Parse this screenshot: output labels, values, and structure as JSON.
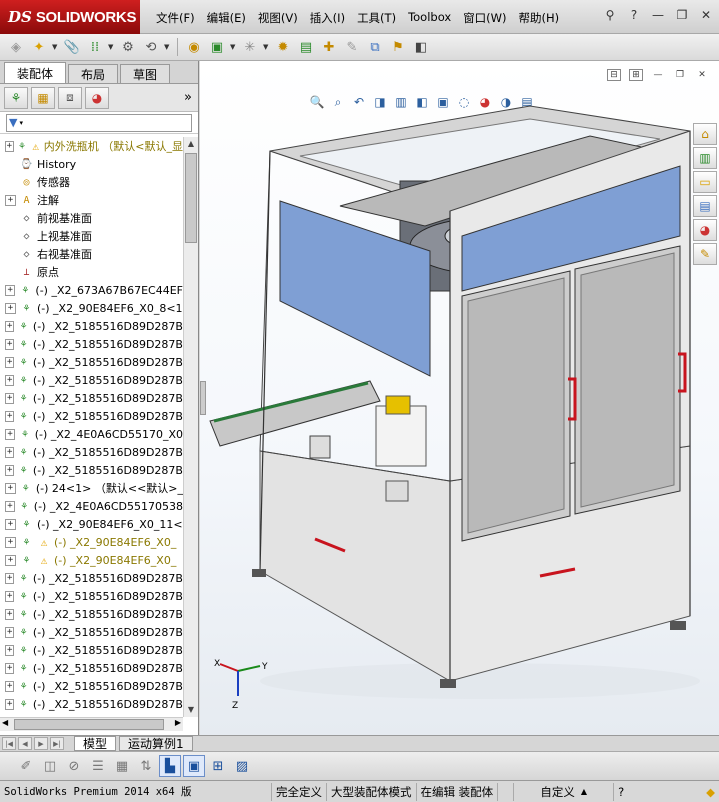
{
  "titlebar": {
    "logo_ds": "DS",
    "logo_text": "SOLIDWORKS",
    "menu": [
      "文件(F)",
      "编辑(E)",
      "视图(V)",
      "插入(I)",
      "工具(T)",
      "Toolbox",
      "窗口(W)",
      "帮助(H)"
    ]
  },
  "window_controls": {
    "help": "?",
    "minimize": "—",
    "restore": "❐",
    "close": "✕"
  },
  "left_panel": {
    "tabs": [
      "装配体",
      "布局",
      "草图"
    ],
    "active_tab": "装配体",
    "collapse_symbol": "»",
    "tree": [
      {
        "expand": "+",
        "icon": "assembly",
        "warn": true,
        "label": "内外洗瓶机  （默认<默认_显"
      },
      {
        "expand": "",
        "icon": "history",
        "label": "History"
      },
      {
        "expand": "",
        "icon": "sensor",
        "label": "传感器"
      },
      {
        "expand": "+",
        "icon": "annotation",
        "label": "注解"
      },
      {
        "expand": "",
        "icon": "plane",
        "label": "前视基准面"
      },
      {
        "expand": "",
        "icon": "plane",
        "label": "上视基准面"
      },
      {
        "expand": "",
        "icon": "plane",
        "label": "右视基准面"
      },
      {
        "expand": "",
        "icon": "origin",
        "label": "原点"
      },
      {
        "expand": "+",
        "icon": "part",
        "label": "(-) _X2_673A67B67EC44EF"
      },
      {
        "expand": "+",
        "icon": "part",
        "label": "(-) _X2_90E84EF6_X0_8<1"
      },
      {
        "expand": "+",
        "icon": "part",
        "label": "(-) _X2_5185516D89D287B"
      },
      {
        "expand": "+",
        "icon": "part",
        "label": "(-) _X2_5185516D89D287B"
      },
      {
        "expand": "+",
        "icon": "part",
        "label": "(-) _X2_5185516D89D287B"
      },
      {
        "expand": "+",
        "icon": "part",
        "label": "(-) _X2_5185516D89D287B"
      },
      {
        "expand": "+",
        "icon": "part",
        "label": "(-) _X2_5185516D89D287B"
      },
      {
        "expand": "+",
        "icon": "part",
        "label": "(-) _X2_5185516D89D287B"
      },
      {
        "expand": "+",
        "icon": "part",
        "label": "(-) _X2_4E0A6CD55170_X0"
      },
      {
        "expand": "+",
        "icon": "part",
        "label": "(-) _X2_5185516D89D287B"
      },
      {
        "expand": "+",
        "icon": "part",
        "label": "(-) _X2_5185516D89D287B"
      },
      {
        "expand": "+",
        "icon": "part",
        "label": "(-) 24<1> （默认<<默认>_"
      },
      {
        "expand": "+",
        "icon": "part",
        "label": "(-) _X2_4E0A6CD55170538"
      },
      {
        "expand": "+",
        "icon": "part",
        "label": "(-) _X2_90E84EF6_X0_11<"
      },
      {
        "expand": "+",
        "icon": "part",
        "warn": true,
        "label": "(-) _X2_90E84EF6_X0_"
      },
      {
        "expand": "+",
        "icon": "part",
        "warn": true,
        "label": "(-) _X2_90E84EF6_X0_"
      },
      {
        "expand": "+",
        "icon": "part",
        "label": "(-) _X2_5185516D89D287B"
      },
      {
        "expand": "+",
        "icon": "part",
        "label": "(-) _X2_5185516D89D287B"
      },
      {
        "expand": "+",
        "icon": "part",
        "label": "(-) _X2_5185516D89D287B"
      },
      {
        "expand": "+",
        "icon": "part",
        "label": "(-) _X2_5185516D89D287B"
      },
      {
        "expand": "+",
        "icon": "part",
        "label": "(-) _X2_5185516D89D287B"
      },
      {
        "expand": "+",
        "icon": "part",
        "label": "(-) _X2_5185516D89D287B"
      },
      {
        "expand": "+",
        "icon": "part",
        "label": "(-) _X2_5185516D89D287B"
      },
      {
        "expand": "+",
        "icon": "part",
        "label": "(-) _X2_5185516D89D287B"
      },
      {
        "expand": "+",
        "icon": "part",
        "label": "(-) _X2_5185516D89D287B"
      }
    ]
  },
  "triad": {
    "x": "X",
    "y": "Y",
    "z": "Z"
  },
  "bottom_tabs": [
    "模型",
    "运动算例1"
  ],
  "active_bottom_tab": "模型",
  "status": {
    "app": "SolidWorks Premium 2014 x64 版",
    "definition": "完全定义",
    "mode": "大型装配体模式",
    "editing": "在编辑 装配体",
    "custom": "自定义"
  },
  "colors": {
    "brand": "#b01313",
    "frame": "#dcdcdc",
    "panel_blue": "#7f9fd4",
    "handle_red": "#c8141e"
  }
}
